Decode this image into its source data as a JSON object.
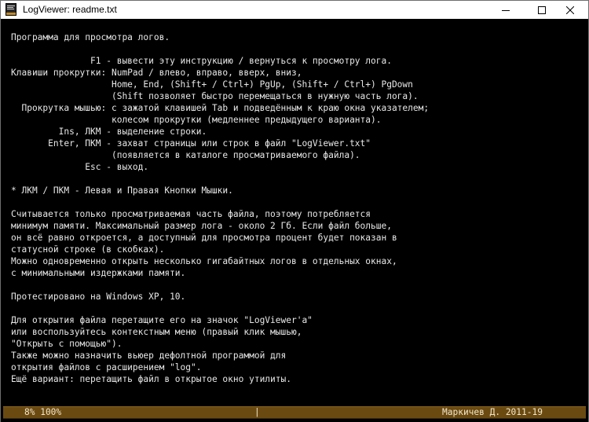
{
  "window": {
    "title": "LogViewer: readme.txt",
    "controls": [
      "minimize",
      "maximize",
      "close"
    ]
  },
  "log": {
    "lines": [
      "Программа для просмотра логов.",
      "",
      "               F1 - вывести эту инструкцию / вернуться к просмотру лога.",
      "Клавиши прокрутки: NumPad / влево, вправо, вверх, вниз,",
      "                   Home, End, (Shift+ / Ctrl+) PgUp, (Shift+ / Ctrl+) PgDown",
      "                   (Shift позволяет быстро перемещаться в нужную часть лога).",
      "  Прокрутка мышью: с зажатой клавишей Tab и подведённым к краю окна указателем;",
      "                   колесом прокрутки (медленнее предыдущего варианта).",
      "         Ins, ЛКМ - выделение строки.",
      "       Enter, ПКМ - захват страницы или строк в файл \"LogViewer.txt\"",
      "                   (появляется в каталоге просматриваемого файла).",
      "              Esc - выход.",
      "",
      "* ЛКМ / ПКМ - Левая и Правая Кнопки Мышки.",
      "",
      "Считывается только просматриваемая часть файла, поэтому потребляется",
      "минимум памяти. Максимальный размер лога - около 2 Гб. Если файл больше,",
      "он всё равно откроется, а доступный для просмотра процент будет показан в",
      "статусной строке (в скобках).",
      "Можно одновременно открыть несколько гигабайтных логов в отдельных окнах,",
      "с минимальными издержками памяти.",
      "",
      "Протестировано на Windows XP, 10.",
      "",
      "Для открытия файла перетащите его на значок \"LogViewer'а\"",
      "или воспользуйтесь контекстным меню (правый клик мышью,",
      "\"Открыть с помощью\").",
      "Также можно назначить вьюер дефолтной программой для",
      "открытия файлов с расширением \"log\".",
      "Ещё вариант: перетащить файл в открытое окно утилиты."
    ]
  },
  "status": {
    "progress": "8% 100%",
    "separator": "|",
    "credits": "Маркичев Д. 2011-19"
  },
  "colors": {
    "background": "#000000",
    "text": "#e8e8e8",
    "statusbar": "#6b4a12",
    "statusbar_text": "#f2e6c8"
  }
}
